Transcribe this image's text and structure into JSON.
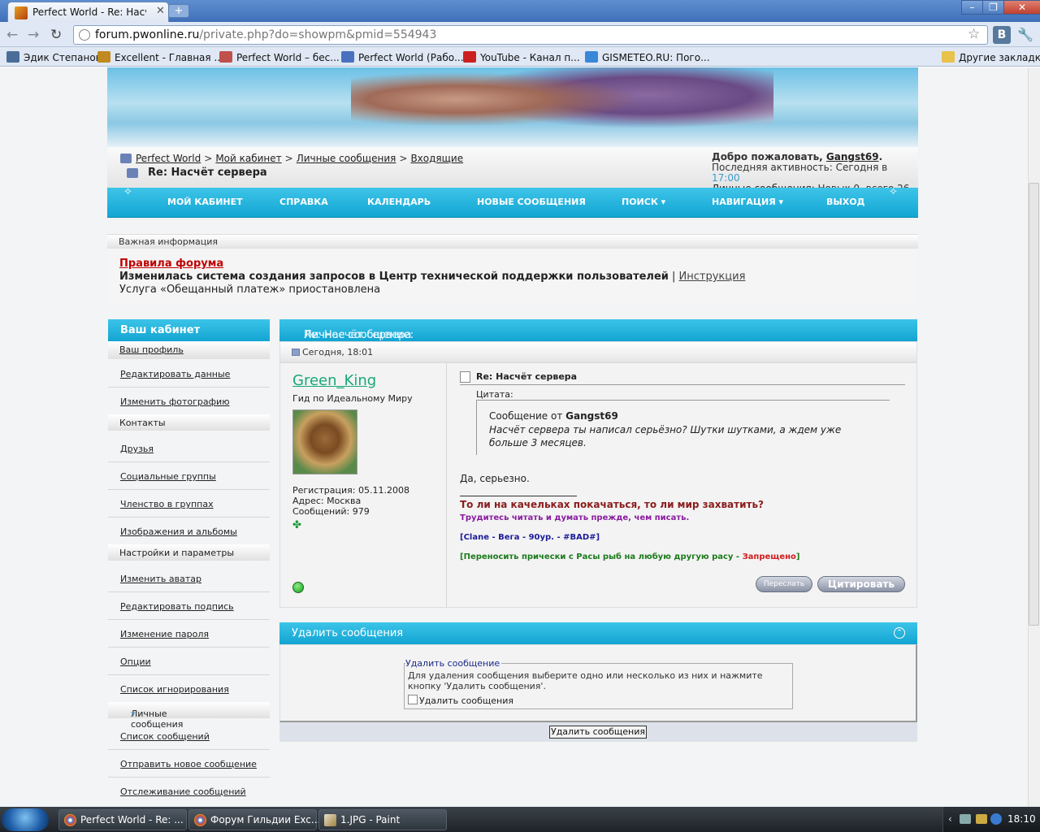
{
  "browser": {
    "tab_title": "Perfect World - Re: Насч...",
    "url_host": "forum.pwonline.ru",
    "url_path": "/private.php?do=showpm&pmid=554943",
    "vk_label": "В",
    "bookmarks": [
      {
        "label": "Эдик Степанов",
        "icon": "vk-icon",
        "color": "#4a6e97"
      },
      {
        "label": "Excellent - Главная ...",
        "icon": "excellent-icon",
        "color": "#c08a20"
      },
      {
        "label": "Perfect World – бес...",
        "icon": "pw-icon",
        "color": "#c0504a"
      },
      {
        "label": "Perfect World (Рабо...",
        "icon": "pw-icon",
        "color": "#4a70c0"
      },
      {
        "label": "YouTube - Канал п...",
        "icon": "youtube-icon",
        "color": "#cc2020"
      },
      {
        "label": "GISMETEO.RU: Пого...",
        "icon": "gismeteo-icon",
        "color": "#3a86d8"
      },
      {
        "label": "Другие закладки",
        "icon": "folder-icon",
        "color": "#e8c24a"
      }
    ]
  },
  "forum": {
    "breadcrumb": [
      "Perfect World",
      "Мой кабинет",
      "Личные сообщения",
      "Входящие"
    ],
    "breadcrumb_sep": ">",
    "thread_title": "Re: Насчёт сервера",
    "welcome_prefix": "Добро пожаловать, ",
    "welcome_user": "Gangst69",
    "welcome_suffix": ".",
    "last_activity_prefix": "Последняя активность: Сегодня в ",
    "last_activity_time": "17:00",
    "pm_link": "Личные сообщения",
    "pm_counts": ": Новых 0, всего 26.",
    "nav": [
      "МОЙ КАБИНЕТ",
      "СПРАВКА",
      "КАЛЕНДАРЬ",
      "НОВЫЕ СООБЩЕНИЯ",
      "ПОИСК ▾",
      "НАВИГАЦИЯ ▾",
      "ВЫХОД"
    ]
  },
  "notice": {
    "header": "Важная информация",
    "rules": "Правила форума",
    "line2": "Изменилась система создания запросов в Центр технической поддержки пользователей",
    "line2_sep": " | ",
    "line2_link": "Инструкция",
    "line3": "Услуга «Обещанный платеж» приостановлена"
  },
  "sidebar": {
    "title": "Ваш кабинет",
    "profile_link": "Ваш профиль",
    "group1": [
      "Редактировать данные",
      "Изменить фотографию"
    ],
    "contacts_title": "Контакты",
    "group2": [
      "Друзья",
      "Социальные группы",
      "Членство в группах",
      "Изображения и альбомы"
    ],
    "settings_title": "Настройки и параметры",
    "group3": [
      "Изменить аватар",
      "Редактировать подпись",
      "Изменение пароля",
      "Опции",
      "Список игнорирования"
    ],
    "pm_title": "Личные сообщения",
    "group4": [
      "Список сообщений",
      "Отправить новое сообщение",
      "Отслеживание сообщений"
    ]
  },
  "message": {
    "header_prefix": "Личное сообщение:",
    "header_title": " Re: Насчёт сервера",
    "date": "Сегодня, 18:01",
    "author": "Green_King",
    "author_title": "Гид по Идеальному Миру",
    "reg": "Регистрация: 05.11.2008",
    "address": "Адрес: Москва",
    "posts": "Сообщений: 979",
    "post_title": "Re: Насчёт сервера",
    "quote_label": "Цитата:",
    "quote_from_prefix": "Сообщение от ",
    "quote_from_user": "Gangst69",
    "quote_text": "Насчёт сервера ты написал серьёзно? Шутки шутками, а ждем уже больше 3 месяцев.",
    "reply": "Да, серьезно.",
    "sig1": "То ли на качельках покачаться, то ли мир захватить?",
    "sig2": "Трудитесь читать и думать прежде, чем писать.",
    "sig3": "[Clane - Вега - 90ур. - #BAD#]",
    "sig4_prefix": "[Переносить прически с Расы рыб на любую другую расу - ",
    "sig4_red": "Запрещено",
    "sig4_suffix": "]",
    "forward_btn": "Переслать",
    "quote_btn": "Цитировать"
  },
  "delete": {
    "header": "Удалить сообщения",
    "legend": "Удалить сообщение",
    "desc": "Для удаления сообщения выберите одно или несколько из них и нажмите кнопку 'Удалить сообщения'.",
    "checkbox_label": "Удалить сообщения",
    "button": "Удалить сообщения"
  },
  "taskbar": {
    "tasks": [
      "Perfect World - Re: ...",
      "Форум Гильдии Exc...",
      "1.JPG - Paint"
    ],
    "clock": "18:10"
  }
}
